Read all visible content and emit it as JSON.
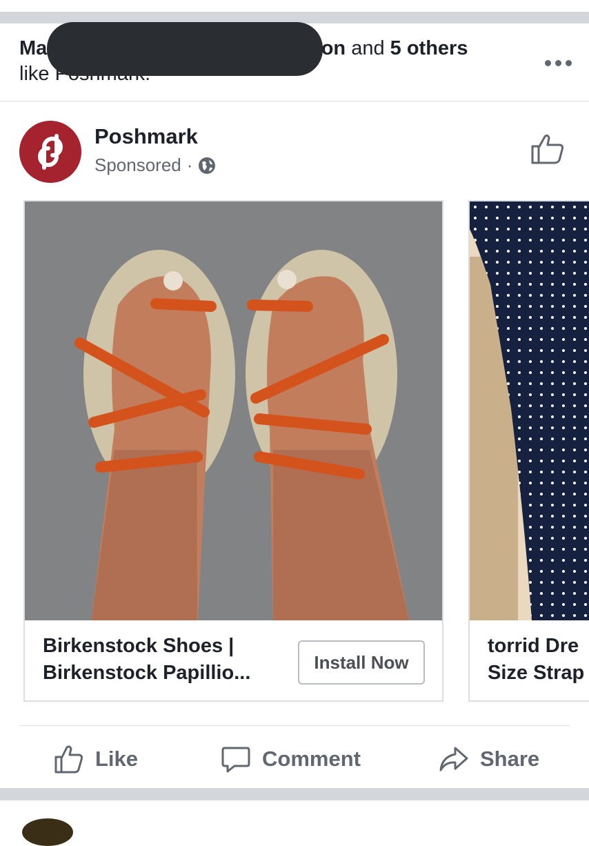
{
  "social_context": {
    "name_start": "Ma",
    "name_end": "rson",
    "mid": " and ",
    "others": "5 others",
    "line2": "like Poshmark."
  },
  "post": {
    "page_name": "Poshmark",
    "sponsored": "Sponsored",
    "separator": "·"
  },
  "carousel": [
    {
      "line1": "Birkenstock Shoes |",
      "line2": "Birkenstock Papillio...",
      "button": "Install Now"
    },
    {
      "line1": "torrid Dre",
      "line2": "Size Strap"
    }
  ],
  "actions": {
    "like": "Like",
    "comment": "Comment",
    "share": "Share"
  },
  "colors": {
    "brand": "#a4232f",
    "text": "#1d2129",
    "secondary": "#606770",
    "divider": "#d3d6db"
  },
  "icons": [
    "more-icon",
    "globe-icon",
    "like-page-icon",
    "like-icon",
    "comment-icon",
    "share-icon"
  ]
}
